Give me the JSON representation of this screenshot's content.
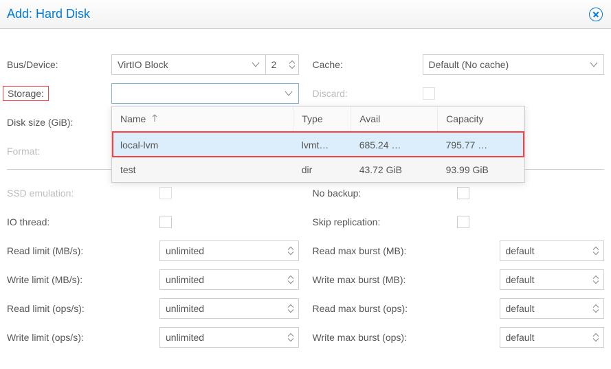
{
  "dialog": {
    "title": "Add: Hard Disk"
  },
  "left": {
    "bus_device_label": "Bus/Device:",
    "bus_value": "VirtIO Block",
    "device_value": "2",
    "storage_label": "Storage:",
    "storage_value": "",
    "disk_size_label": "Disk size (GiB):",
    "format_label": "Format:",
    "ssd_emulation_label": "SSD emulation:",
    "io_thread_label": "IO thread:",
    "read_limit_mbs_label": "Read limit (MB/s):",
    "read_limit_mbs_value": "unlimited",
    "write_limit_mbs_label": "Write limit (MB/s):",
    "write_limit_mbs_value": "unlimited",
    "read_limit_ops_label": "Read limit (ops/s):",
    "read_limit_ops_value": "unlimited",
    "write_limit_ops_label": "Write limit (ops/s):",
    "write_limit_ops_value": "unlimited"
  },
  "right": {
    "cache_label": "Cache:",
    "cache_value": "Default (No cache)",
    "discard_label": "Discard:",
    "no_backup_label": "No backup:",
    "skip_replication_label": "Skip replication:",
    "read_max_burst_mb_label": "Read max burst (MB):",
    "read_max_burst_mb_value": "default",
    "write_max_burst_mb_label": "Write max burst (MB):",
    "write_max_burst_mb_value": "default",
    "read_max_burst_ops_label": "Read max burst (ops):",
    "read_max_burst_ops_value": "default",
    "write_max_burst_ops_label": "Write max burst (ops):",
    "write_max_burst_ops_value": "default"
  },
  "dropdown": {
    "cols": {
      "name": "Name",
      "type": "Type",
      "avail": "Avail",
      "capacity": "Capacity"
    },
    "rows": [
      {
        "name": "local-lvm",
        "type": "lvmt…",
        "avail": "685.24 …",
        "capacity": "795.77 …"
      },
      {
        "name": "test",
        "type": "dir",
        "avail": "43.72 GiB",
        "capacity": "93.99 GiB"
      }
    ]
  }
}
